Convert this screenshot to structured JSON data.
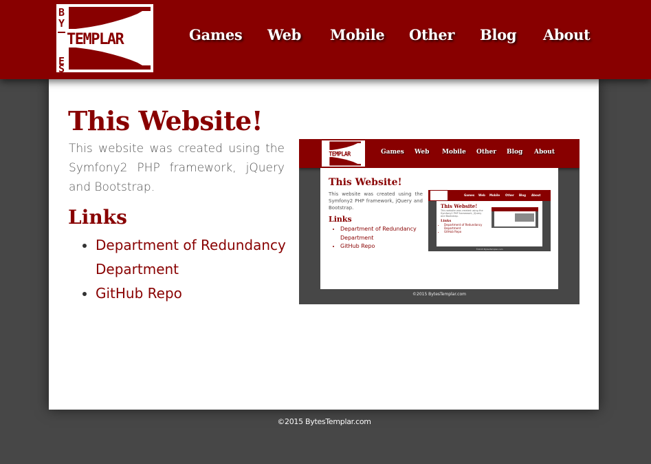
{
  "header": {
    "logo": {
      "text": "BYTES TEMPLAR",
      "icon": "bytes-templar-logo"
    },
    "nav": [
      {
        "label": "Games"
      },
      {
        "label": "Web"
      },
      {
        "label": "Mobile"
      },
      {
        "label": "Other"
      },
      {
        "label": "Blog"
      },
      {
        "label": "About"
      }
    ]
  },
  "main": {
    "title": "This Website!",
    "intro": "This website was created using the Symfony2 PHP framework, jQuery and Bootstrap.",
    "links_heading": "Links",
    "links": [
      {
        "label": "Department of Redundancy Department"
      },
      {
        "label": "GitHub Repo"
      }
    ],
    "screenshot": {
      "nav": [
        "Games",
        "Web",
        "Mobile",
        "Other",
        "Blog",
        "About"
      ],
      "title": "This Website!",
      "intro": "This website was created using the Symfony2 PHP framework, jQuery and Bootstrap.",
      "links_heading": "Links",
      "links": [
        "Department of Redundancy Department",
        "GitHub Repo"
      ],
      "footer": "©2015 BytesTemplar.com"
    }
  },
  "footer": {
    "copyright": "©2015 BytesTemplar.com"
  },
  "colors": {
    "brand": "#880000",
    "background": "#474747",
    "card": "#ffffff"
  }
}
